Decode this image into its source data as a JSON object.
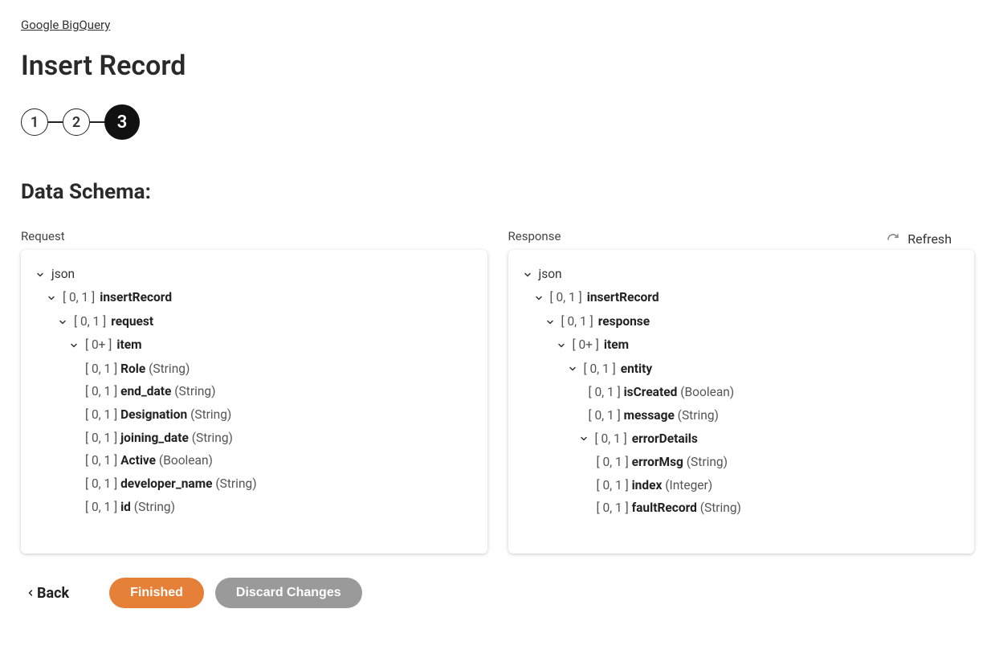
{
  "breadcrumb": "Google BigQuery",
  "title": "Insert Record",
  "steps": [
    "1",
    "2",
    "3"
  ],
  "activeStep": 2,
  "section": "Data Schema:",
  "refresh": {
    "label": "Refresh"
  },
  "requestTitle": "Request",
  "responseTitle": "Response",
  "request": {
    "root": "json",
    "l1": {
      "card": "[ 0, 1 ]",
      "name": "insertRecord"
    },
    "l2": {
      "card": "[ 0, 1 ]",
      "name": "request"
    },
    "l3": {
      "card": "[ 0+ ]",
      "name": "item"
    },
    "fields": [
      {
        "card": "[ 0, 1 ]",
        "name": "Role",
        "type": "(String)"
      },
      {
        "card": "[ 0, 1 ]",
        "name": "end_date",
        "type": "(String)"
      },
      {
        "card": "[ 0, 1 ]",
        "name": "Designation",
        "type": "(String)"
      },
      {
        "card": "[ 0, 1 ]",
        "name": "joining_date",
        "type": "(String)"
      },
      {
        "card": "[ 0, 1 ]",
        "name": "Active",
        "type": "(Boolean)"
      },
      {
        "card": "[ 0, 1 ]",
        "name": "developer_name",
        "type": "(String)"
      },
      {
        "card": "[ 0, 1 ]",
        "name": "id",
        "type": "(String)"
      }
    ]
  },
  "response": {
    "root": "json",
    "l1": {
      "card": "[ 0, 1 ]",
      "name": "insertRecord"
    },
    "l2": {
      "card": "[ 0, 1 ]",
      "name": "response"
    },
    "l3": {
      "card": "[ 0+ ]",
      "name": "item"
    },
    "l4": {
      "card": "[ 0, 1 ]",
      "name": "entity"
    },
    "fieldsA": [
      {
        "card": "[ 0, 1 ]",
        "name": "isCreated",
        "type": "(Boolean)"
      },
      {
        "card": "[ 0, 1 ]",
        "name": "message",
        "type": "(String)"
      }
    ],
    "l5": {
      "card": "[ 0, 1 ]",
      "name": "errorDetails"
    },
    "fieldsB": [
      {
        "card": "[ 0, 1 ]",
        "name": "errorMsg",
        "type": "(String)"
      },
      {
        "card": "[ 0, 1 ]",
        "name": "index",
        "type": "(Integer)"
      },
      {
        "card": "[ 0, 1 ]",
        "name": "faultRecord",
        "type": "(String)"
      }
    ]
  },
  "actions": {
    "back": "Back",
    "finished": "Finished",
    "discard": "Discard Changes"
  }
}
